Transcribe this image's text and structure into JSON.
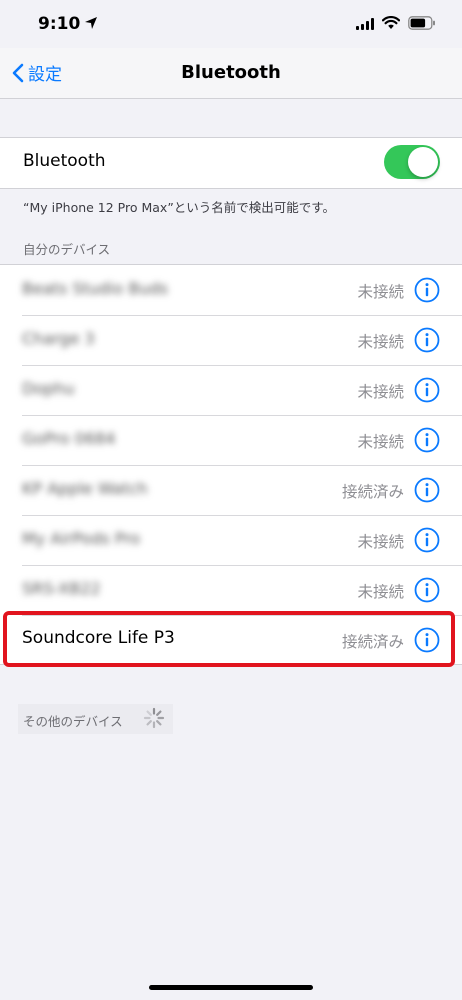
{
  "status_bar": {
    "time": "9:10"
  },
  "nav": {
    "back_label": "設定",
    "title": "Bluetooth"
  },
  "bluetooth": {
    "label": "Bluetooth",
    "enabled": true,
    "toggle_color": "#34c759"
  },
  "discoverable_note": "“My iPhone 12 Pro Max”という名前で検出可能です。",
  "my_devices": {
    "header": "自分のデバイス",
    "items": [
      {
        "name": "Beats Studio Buds",
        "status": "未接続",
        "blurred": true
      },
      {
        "name": "Charge 3",
        "status": "未接続",
        "blurred": true
      },
      {
        "name": "Dophu",
        "status": "未接続",
        "blurred": true
      },
      {
        "name": "GoPro 0684",
        "status": "未接続",
        "blurred": true
      },
      {
        "name": "KP Apple Watch",
        "status": "接続済み",
        "blurred": true
      },
      {
        "name": "My AirPods Pro",
        "status": "未接続",
        "blurred": true
      },
      {
        "name": "SRS-XB22",
        "status": "未接続",
        "blurred": true
      },
      {
        "name": "Soundcore Life P3",
        "status": "接続済み",
        "blurred": false,
        "highlighted": true
      }
    ]
  },
  "other_devices": {
    "header": "その他のデバイス"
  },
  "colors": {
    "accent": "#0a7aff",
    "highlight": "#e1141e",
    "background": "#f2f2f7"
  }
}
